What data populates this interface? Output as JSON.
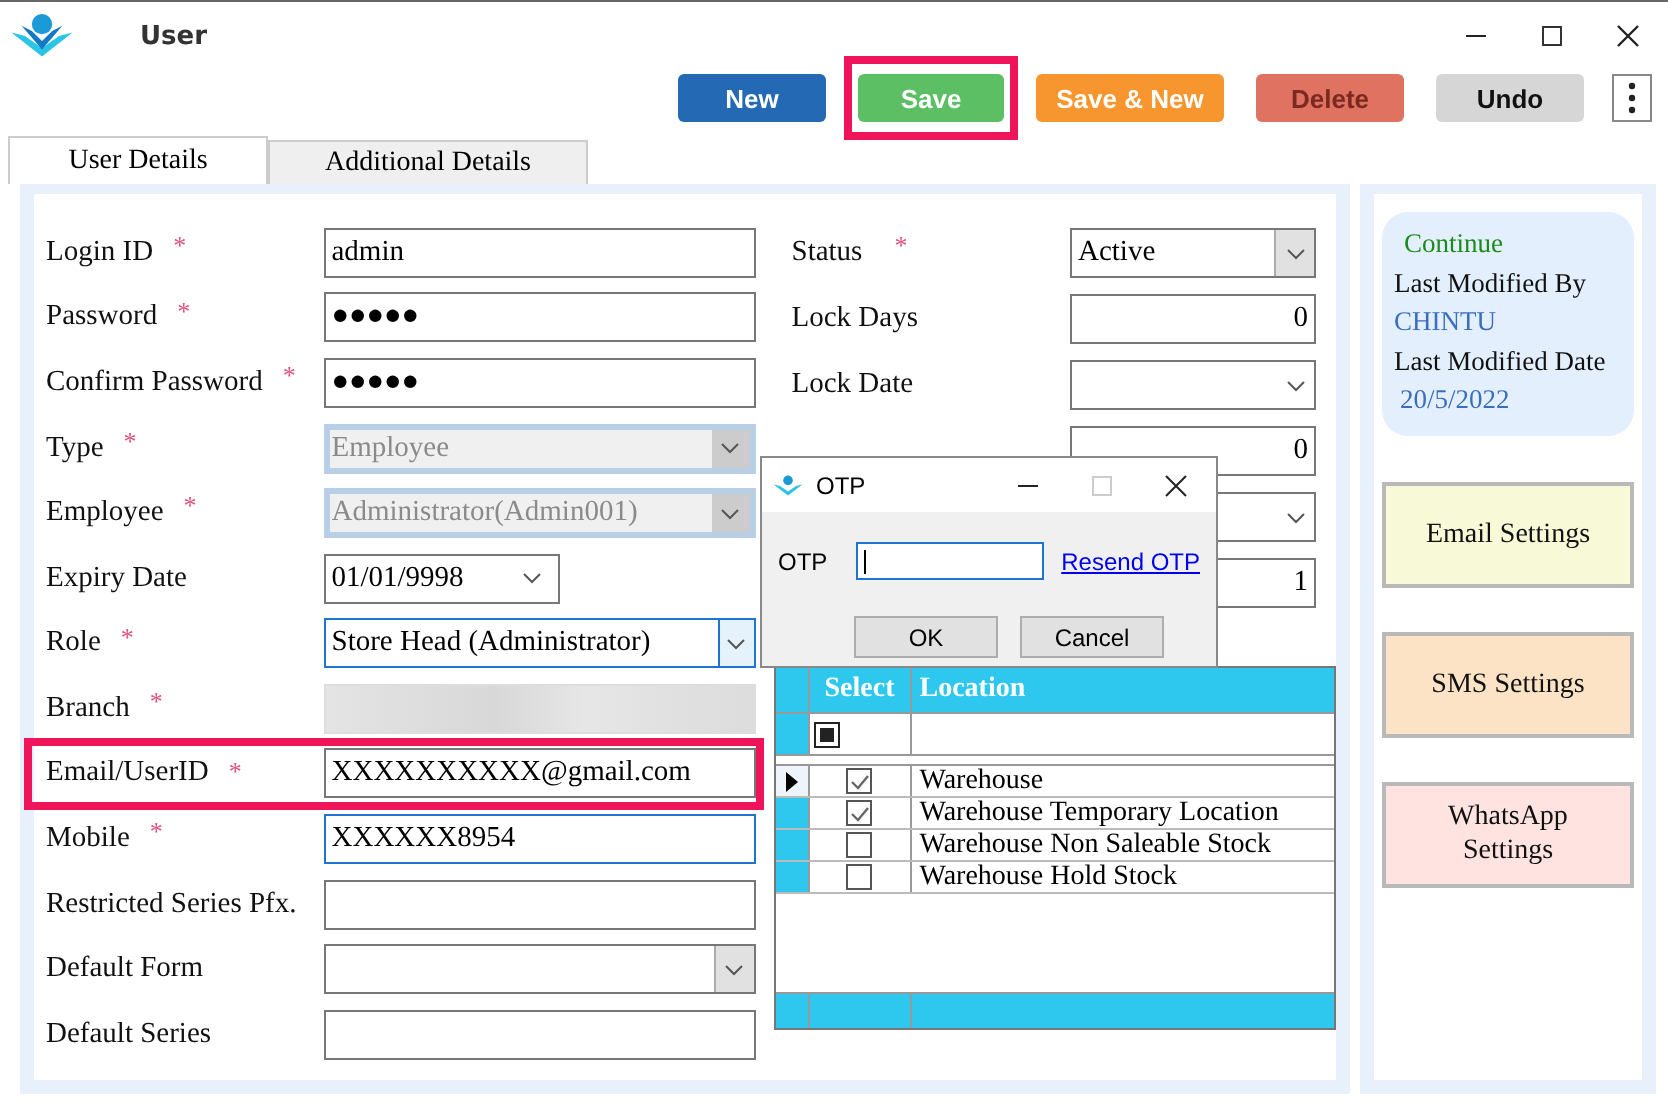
{
  "window": {
    "title": "User"
  },
  "toolbar": {
    "buttons": [
      {
        "label": "New",
        "kind": "new",
        "highlighted": false
      },
      {
        "label": "Save",
        "kind": "save",
        "highlighted": true
      },
      {
        "label": "Save & New",
        "kind": "savenew",
        "highlighted": false
      },
      {
        "label": "Delete",
        "kind": "delete",
        "highlighted": false
      },
      {
        "label": "Undo",
        "kind": "undo",
        "highlighted": false
      }
    ]
  },
  "tabs": [
    {
      "label": "User Details",
      "selected": true
    },
    {
      "label": "Additional Details",
      "selected": false
    }
  ],
  "form_left": [
    {
      "label": "Login ID",
      "mark": "*",
      "kind": "text",
      "value": "admin"
    },
    {
      "label": "Password",
      "mark": "*",
      "kind": "text",
      "value": "●●●●●"
    },
    {
      "label": "Confirm Password",
      "mark": "*",
      "kind": "text",
      "value": "●●●●●"
    },
    {
      "label": "Type",
      "mark": "*",
      "kind": "select",
      "disabled": true,
      "value": "Employee"
    },
    {
      "label": "Employee",
      "mark": "*",
      "kind": "select",
      "disabled": true,
      "value": "Administrator(Admin001)"
    },
    {
      "label": "Expiry Date",
      "kind": "date",
      "value": "01/01/9998"
    },
    {
      "label": "Role",
      "mark": "*",
      "kind": "select",
      "focused": true,
      "value": "Store Head (Administrator)"
    },
    {
      "label": "Branch",
      "mark": "*",
      "kind": "blurred"
    },
    {
      "label": "Email/UserID",
      "mark": "*",
      "kind": "text",
      "value": "XXXXXXXXXX@gmail.com",
      "highlighted": true
    },
    {
      "label": "Mobile",
      "mark": "*",
      "kind": "text",
      "focused": true,
      "value": "XXXXXX8954"
    },
    {
      "label": "Restricted Series Pfx.",
      "kind": "text"
    },
    {
      "label": "Default Form",
      "kind": "select"
    },
    {
      "label": "Default Series",
      "kind": "text"
    }
  ],
  "form_right": [
    {
      "label": "Status",
      "mark": "*",
      "kind": "select",
      "value": "Active"
    },
    {
      "label": "Lock Days",
      "kind": "number",
      "value": "0"
    },
    {
      "label": "Lock Date",
      "kind": "select"
    },
    {
      "kind": "number",
      "value": "0"
    },
    {
      "kind": "select"
    },
    {
      "kind": "number",
      "value": "1"
    }
  ],
  "location_grid": {
    "columns": [
      "Select",
      "Location"
    ],
    "select_all_indeterminate": true,
    "rows": [
      {
        "location": "Warehouse",
        "checked": true,
        "current": true
      },
      {
        "location": "Warehouse Temporary Location",
        "checked": true,
        "current": false
      },
      {
        "location": "Warehouse Non Saleable Stock",
        "checked": false,
        "current": false
      },
      {
        "location": "Warehouse Hold Stock",
        "checked": false,
        "current": false
      }
    ]
  },
  "sidebar": {
    "info": {
      "status": "Continue",
      "modified_by_label": "Last Modified By",
      "modified_by": "CHINTU",
      "modified_date_label": "Last Modified Date",
      "modified_date": "20/5/2022"
    },
    "buttons": [
      {
        "label": "Email Settings",
        "color": "#f8f9d6"
      },
      {
        "label": "SMS Settings",
        "color": "#fde3c6"
      },
      {
        "label": "WhatsApp Settings",
        "color": "#fee3e1"
      }
    ]
  },
  "otp_dialog": {
    "title": "OTP",
    "field_label": "OTP",
    "link": "Resend OTP",
    "buttons": [
      "OK",
      "Cancel"
    ]
  }
}
